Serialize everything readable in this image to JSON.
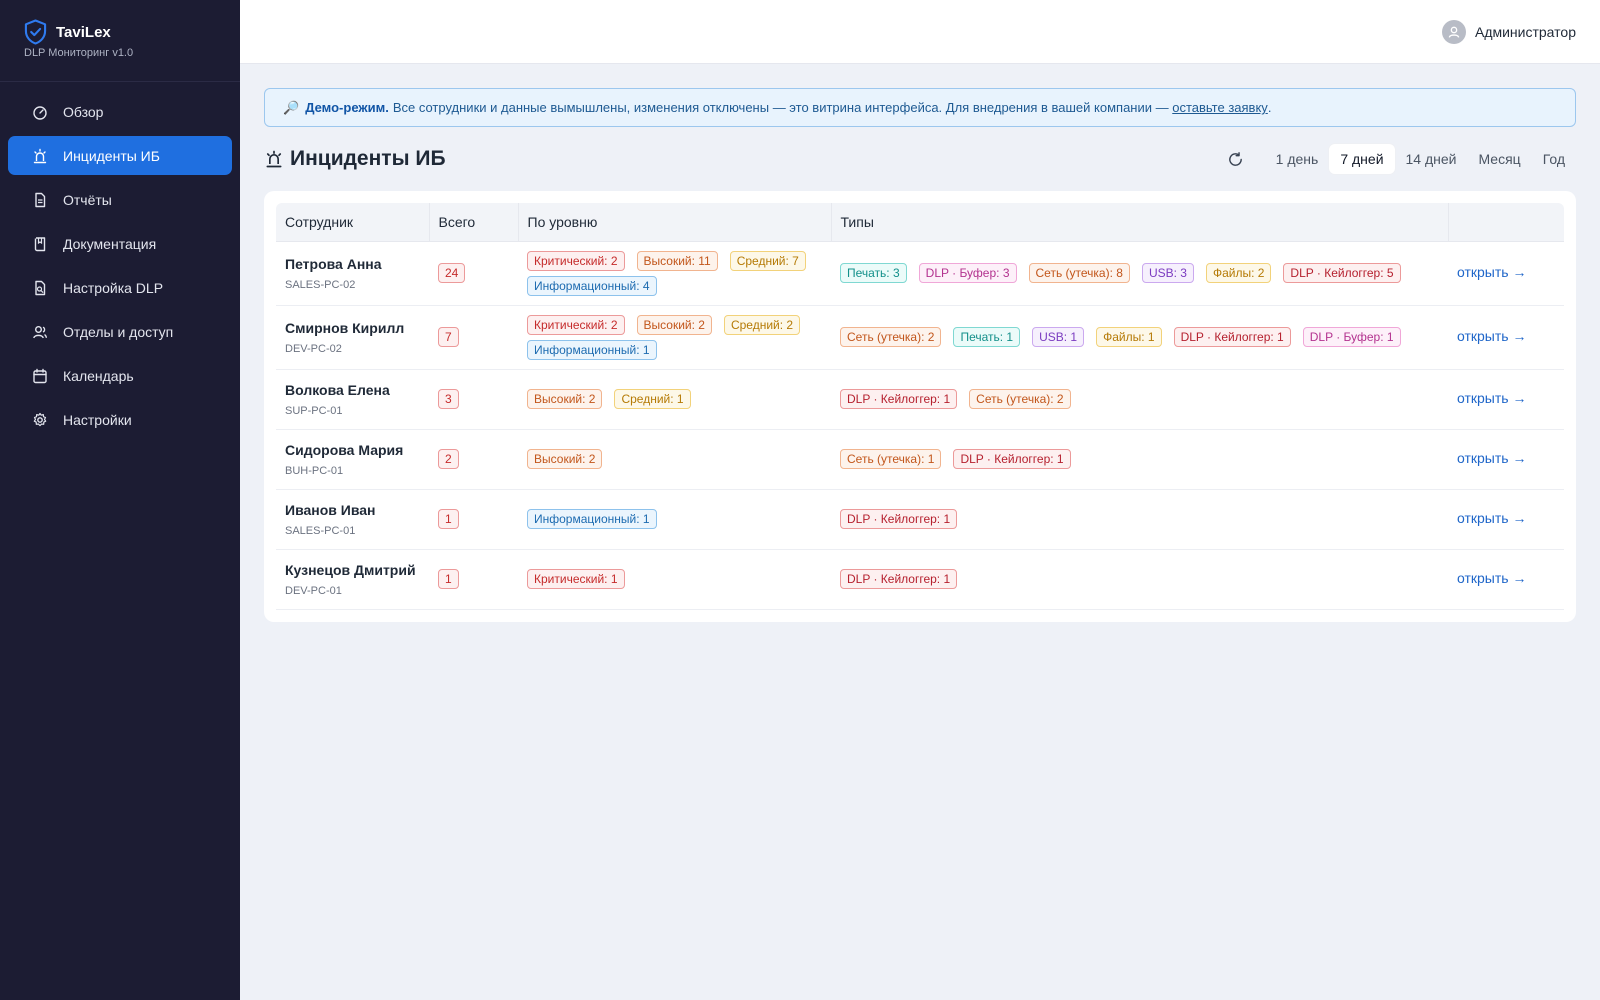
{
  "brand": {
    "name": "TaviLex",
    "subtitle": "DLP Мониторинг v1.0"
  },
  "sidebar": {
    "items": [
      {
        "label": "Обзор",
        "icon": "gauge-icon",
        "active": false
      },
      {
        "label": "Инциденты ИБ",
        "icon": "siren-icon",
        "active": true
      },
      {
        "label": "Отчёты",
        "icon": "file-icon",
        "active": false
      },
      {
        "label": "Документация",
        "icon": "book-icon",
        "active": false
      },
      {
        "label": "Настройка DLP",
        "icon": "file-search-icon",
        "active": false
      },
      {
        "label": "Отделы и доступ",
        "icon": "users-icon",
        "active": false
      },
      {
        "label": "Календарь",
        "icon": "calendar-icon",
        "active": false
      },
      {
        "label": "Настройки",
        "icon": "gear-icon",
        "active": false
      }
    ]
  },
  "header": {
    "user": "Администратор"
  },
  "banner": {
    "icon": "🔎",
    "strong": "Демо-режим.",
    "text": "Все сотрудники и данные вымышлены, изменения отключены — это витрина интерфейса. Для внедрения в вашей компании —",
    "link": "оставьте заявку",
    "tail": "."
  },
  "page": {
    "title": "Инциденты ИБ"
  },
  "periods": [
    {
      "label": "1 день",
      "active": false
    },
    {
      "label": "7 дней",
      "active": true
    },
    {
      "label": "14 дней",
      "active": false
    },
    {
      "label": "Месяц",
      "active": false
    },
    {
      "label": "Год",
      "active": false
    }
  ],
  "table": {
    "headers": {
      "employee": "Сотрудник",
      "total": "Всего",
      "levels": "По уровню",
      "types": "Типы",
      "action": ""
    },
    "open_label": "открыть →",
    "rows": [
      {
        "name": "Петрова Анна",
        "host": "SALES-PC-02",
        "total": "24",
        "levels": [
          {
            "label": "Критический: 2",
            "kind": "crit"
          },
          {
            "label": "Высокий: 11",
            "kind": "high"
          },
          {
            "label": "Средний: 7",
            "kind": "med"
          },
          {
            "label": "Информационный: 4",
            "kind": "info"
          }
        ],
        "types": [
          {
            "label": "Печать: 3",
            "kind": "print"
          },
          {
            "label": "DLP · Буфер: 3",
            "kind": "clip"
          },
          {
            "label": "Сеть (утечка): 8",
            "kind": "net"
          },
          {
            "label": "USB: 3",
            "kind": "usb"
          },
          {
            "label": "Файлы: 2",
            "kind": "files"
          },
          {
            "label": "DLP · Кейлоггер: 5",
            "kind": "key"
          }
        ]
      },
      {
        "name": "Смирнов Кирилл",
        "host": "DEV-PC-02",
        "total": "7",
        "levels": [
          {
            "label": "Критический: 2",
            "kind": "crit"
          },
          {
            "label": "Высокий: 2",
            "kind": "high"
          },
          {
            "label": "Средний: 2",
            "kind": "med"
          },
          {
            "label": "Информационный: 1",
            "kind": "info"
          }
        ],
        "types": [
          {
            "label": "Сеть (утечка): 2",
            "kind": "net"
          },
          {
            "label": "Печать: 1",
            "kind": "print"
          },
          {
            "label": "USB: 1",
            "kind": "usb"
          },
          {
            "label": "Файлы: 1",
            "kind": "files"
          },
          {
            "label": "DLP · Кейлоггер: 1",
            "kind": "key"
          },
          {
            "label": "DLP · Буфер: 1",
            "kind": "clip"
          }
        ]
      },
      {
        "name": "Волкова Елена",
        "host": "SUP-PC-01",
        "total": "3",
        "levels": [
          {
            "label": "Высокий: 2",
            "kind": "high"
          },
          {
            "label": "Средний: 1",
            "kind": "med"
          }
        ],
        "types": [
          {
            "label": "DLP · Кейлоггер: 1",
            "kind": "key"
          },
          {
            "label": "Сеть (утечка): 2",
            "kind": "net"
          }
        ]
      },
      {
        "name": "Сидорова Мария",
        "host": "BUH-PC-01",
        "total": "2",
        "levels": [
          {
            "label": "Высокий: 2",
            "kind": "high"
          }
        ],
        "types": [
          {
            "label": "Сеть (утечка): 1",
            "kind": "net"
          },
          {
            "label": "DLP · Кейлоггер: 1",
            "kind": "key"
          }
        ]
      },
      {
        "name": "Иванов Иван",
        "host": "SALES-PC-01",
        "total": "1",
        "levels": [
          {
            "label": "Информационный: 1",
            "kind": "info"
          }
        ],
        "types": [
          {
            "label": "DLP · Кейлоггер: 1",
            "kind": "key"
          }
        ]
      },
      {
        "name": "Кузнецов Дмитрий",
        "host": "DEV-PC-01",
        "total": "1",
        "levels": [
          {
            "label": "Критический: 1",
            "kind": "crit"
          }
        ],
        "types": [
          {
            "label": "DLP · Кейлоггер: 1",
            "kind": "key"
          }
        ]
      }
    ]
  },
  "colors": {
    "sidebar_bg": "#1c1c33",
    "accent": "#1f6fe0",
    "page_bg": "#eef1f7"
  }
}
